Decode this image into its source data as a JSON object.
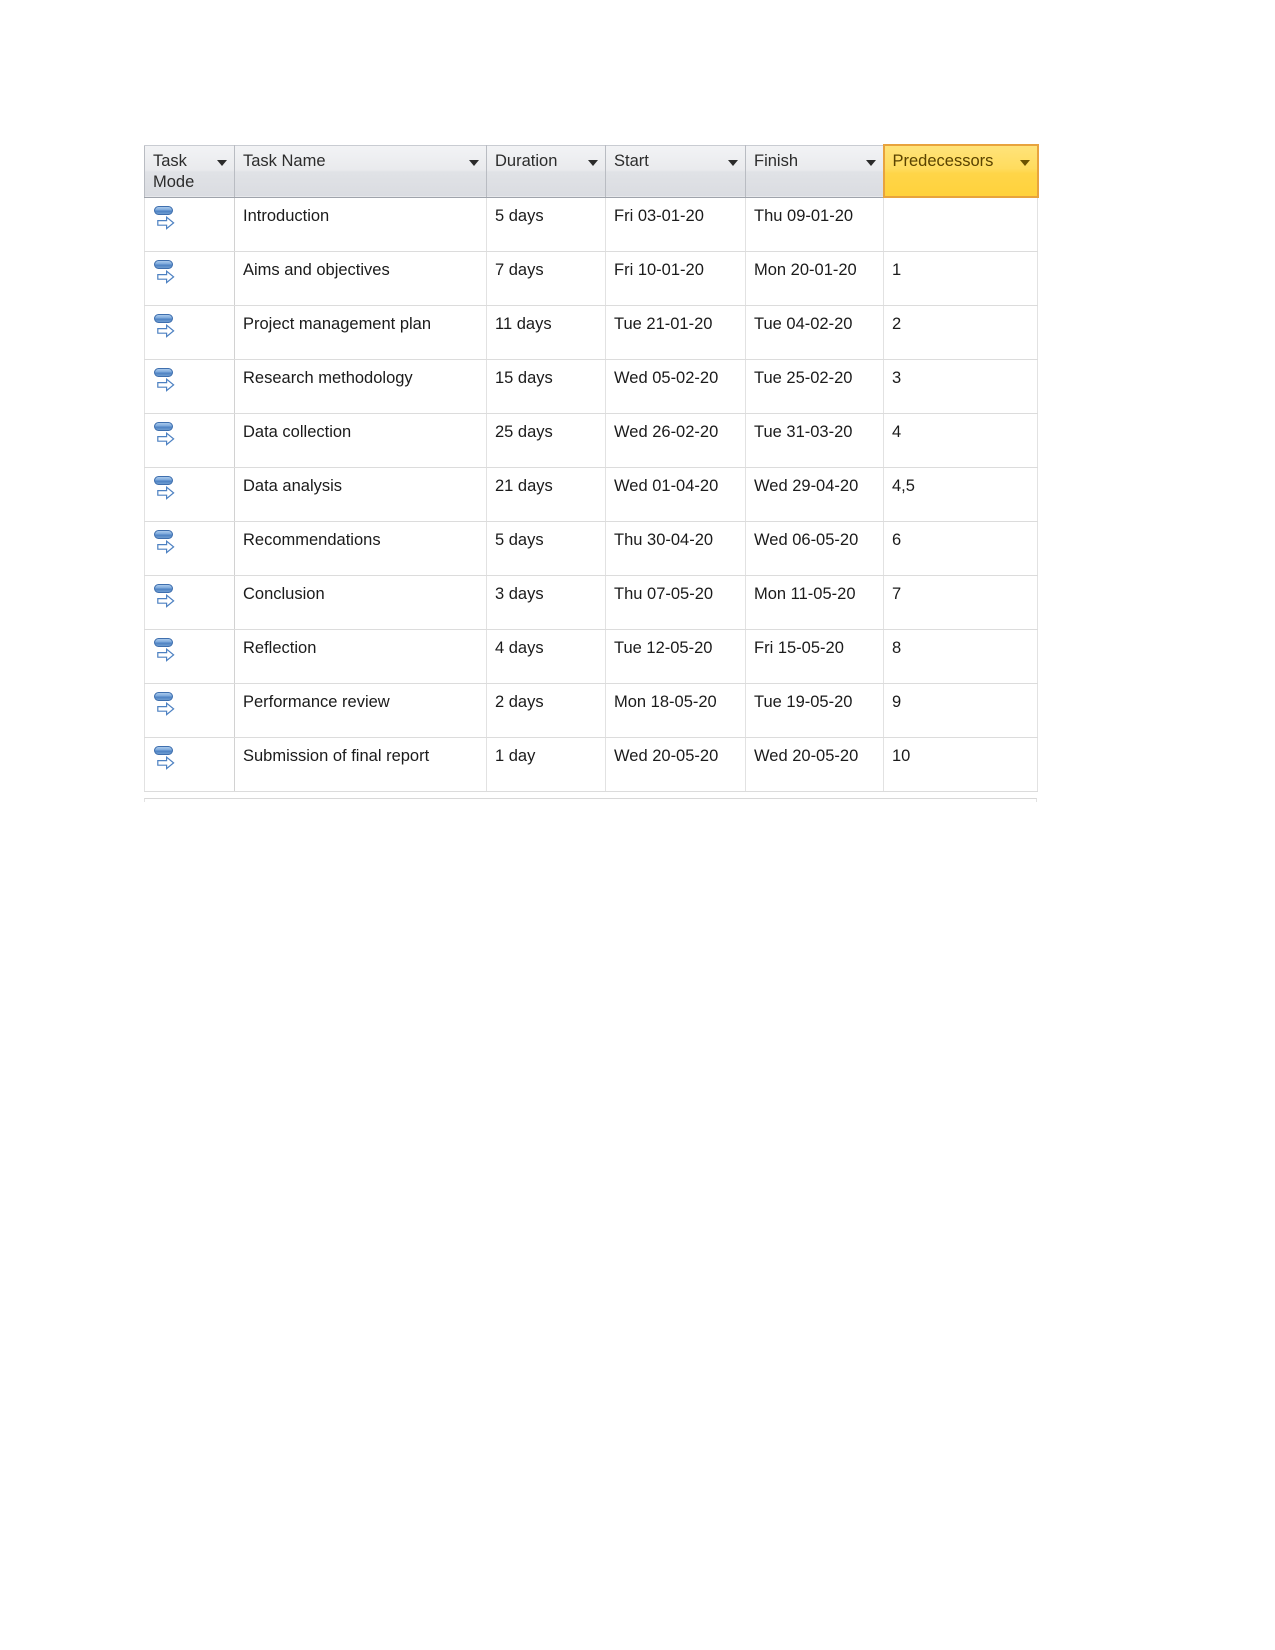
{
  "document": {
    "type": "project-schedule-grid",
    "application_style": "microsoft-project-entry-table"
  },
  "table": {
    "columns": [
      {
        "key": "task_mode",
        "label": "Task\nMode",
        "has_filter_caret": true,
        "selected": false
      },
      {
        "key": "task_name",
        "label": "Task Name",
        "has_filter_caret": true,
        "selected": false
      },
      {
        "key": "duration",
        "label": "Duration",
        "has_filter_caret": true,
        "selected": false
      },
      {
        "key": "start",
        "label": "Start",
        "has_filter_caret": true,
        "selected": false
      },
      {
        "key": "finish",
        "label": "Finish",
        "has_filter_caret": true,
        "selected": false
      },
      {
        "key": "predecessors",
        "label": "Predecessors",
        "has_filter_caret": true,
        "selected": true
      }
    ],
    "selected_column_key": "predecessors",
    "colors": {
      "header_background": "#e6e8eb",
      "header_border": "#b9bcc2",
      "selected_header_background": "#ffd84a",
      "selected_header_border": "#e8a33d",
      "selected_header_text": "#5a4300",
      "row_border": "#dcdcdc",
      "text": "#1b1b1b",
      "task_mode_icon_blue": "#4d81c2",
      "task_mode_icon_outline": "#3f6fae"
    },
    "task_mode_icon_name": "auto-scheduled-task-icon",
    "rows": [
      {
        "task_mode": "auto-scheduled",
        "task_name": "Introduction",
        "duration": "5 days",
        "start": "Fri 03-01-20",
        "finish": "Thu 09-01-20",
        "predecessors": ""
      },
      {
        "task_mode": "auto-scheduled",
        "task_name": "Aims and objectives",
        "duration": "7 days",
        "start": "Fri 10-01-20",
        "finish": "Mon 20-01-20",
        "predecessors": "1"
      },
      {
        "task_mode": "auto-scheduled",
        "task_name": "Project management plan",
        "duration": "11 days",
        "start": "Tue 21-01-20",
        "finish": "Tue 04-02-20",
        "predecessors": "2"
      },
      {
        "task_mode": "auto-scheduled",
        "task_name": "Research methodology",
        "duration": "15 days",
        "start": "Wed 05-02-20",
        "finish": "Tue 25-02-20",
        "predecessors": "3"
      },
      {
        "task_mode": "auto-scheduled",
        "task_name": "Data collection",
        "duration": "25 days",
        "start": "Wed 26-02-20",
        "finish": "Tue 31-03-20",
        "predecessors": "4"
      },
      {
        "task_mode": "auto-scheduled",
        "task_name": "Data analysis",
        "duration": "21 days",
        "start": "Wed 01-04-20",
        "finish": "Wed 29-04-20",
        "predecessors": "4,5"
      },
      {
        "task_mode": "auto-scheduled",
        "task_name": "Recommendations",
        "duration": "5 days",
        "start": "Thu 30-04-20",
        "finish": "Wed 06-05-20",
        "predecessors": "6"
      },
      {
        "task_mode": "auto-scheduled",
        "task_name": "Conclusion",
        "duration": "3 days",
        "start": "Thu 07-05-20",
        "finish": "Mon 11-05-20",
        "predecessors": "7"
      },
      {
        "task_mode": "auto-scheduled",
        "task_name": "Reflection",
        "duration": "4 days",
        "start": "Tue 12-05-20",
        "finish": "Fri 15-05-20",
        "predecessors": "8"
      },
      {
        "task_mode": "auto-scheduled",
        "task_name": "Performance review",
        "duration": "2 days",
        "start": "Mon 18-05-20",
        "finish": "Tue 19-05-20",
        "predecessors": "9"
      },
      {
        "task_mode": "auto-scheduled",
        "task_name": "Submission of final report",
        "duration": "1 day",
        "start": "Wed 20-05-20",
        "finish": "Wed 20-05-20",
        "predecessors": "10"
      }
    ]
  }
}
